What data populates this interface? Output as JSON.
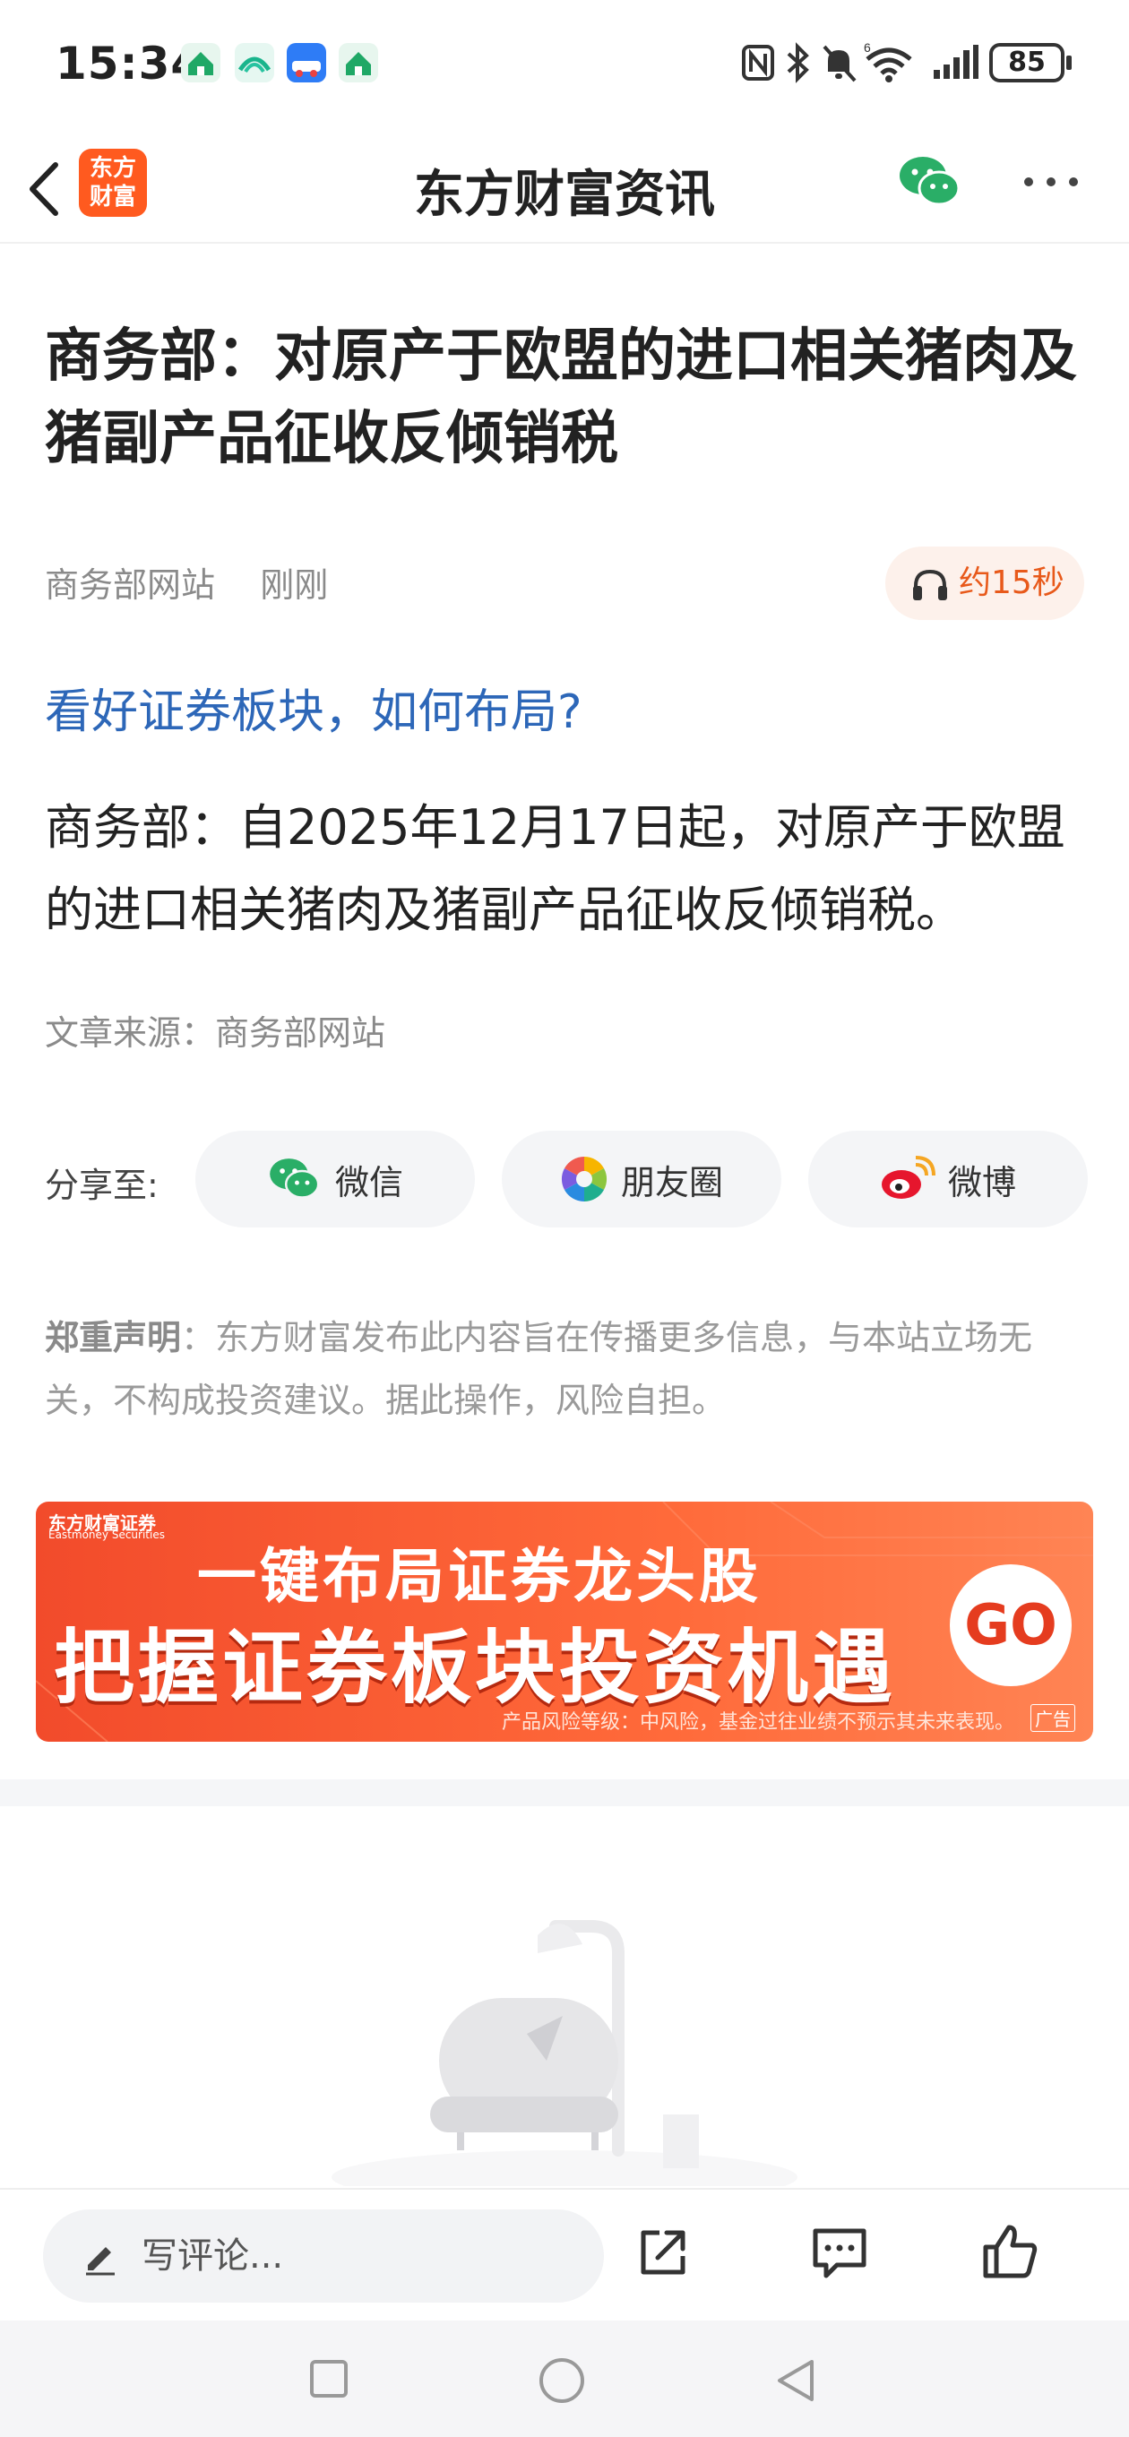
{
  "status_bar": {
    "time": "15:34",
    "battery": "85",
    "app_icons": [
      "home-app-icon",
      "ai-app-icon",
      "car-app-icon",
      "home-app-icon-2"
    ],
    "sys_icons": [
      "nfc-icon",
      "bluetooth-icon",
      "mute-icon",
      "wifi-icon",
      "signal-icon"
    ]
  },
  "nav": {
    "logo_line1": "东方",
    "logo_line2": "财富",
    "title": "东方财富资讯"
  },
  "article": {
    "headline": "商务部：对原产于欧盟的进口相关猪肉及猪副产品征收反倾销税",
    "source_name": "商务部网站",
    "time": "刚刚",
    "listen_label": "约15秒",
    "promo_link": "看好证券板块，如何布局?",
    "body": "商务部：自2025年12月17日起，对原产于欧盟的进口相关猪肉及猪副产品征收反倾销税。",
    "source_line": "文章来源：商务部网站"
  },
  "share": {
    "label": "分享至:",
    "wechat": "微信",
    "moments": "朋友圈",
    "weibo": "微博"
  },
  "disclaimer": {
    "title": "郑重声明",
    "text": "：东方财富发布此内容旨在传播更多信息，与本站立场无关，不构成投资建议。据此操作，风险自担。"
  },
  "banner": {
    "brand": "东方财富证券",
    "brand_en": "Eastmoney Securities",
    "line1": "一键布局证券龙头股",
    "line2": "把握证券板块投资机遇",
    "go": "GO",
    "risk": "产品风险等级：中风险，基金过往业绩不预示其未来表现。",
    "ad_tag": "广告"
  },
  "bottom": {
    "comment_placeholder": "写评论..."
  },
  "colors": {
    "brand_orange": "#ff5a1f",
    "link_blue": "#2d67b8",
    "wechat_green": "#2aae67"
  }
}
